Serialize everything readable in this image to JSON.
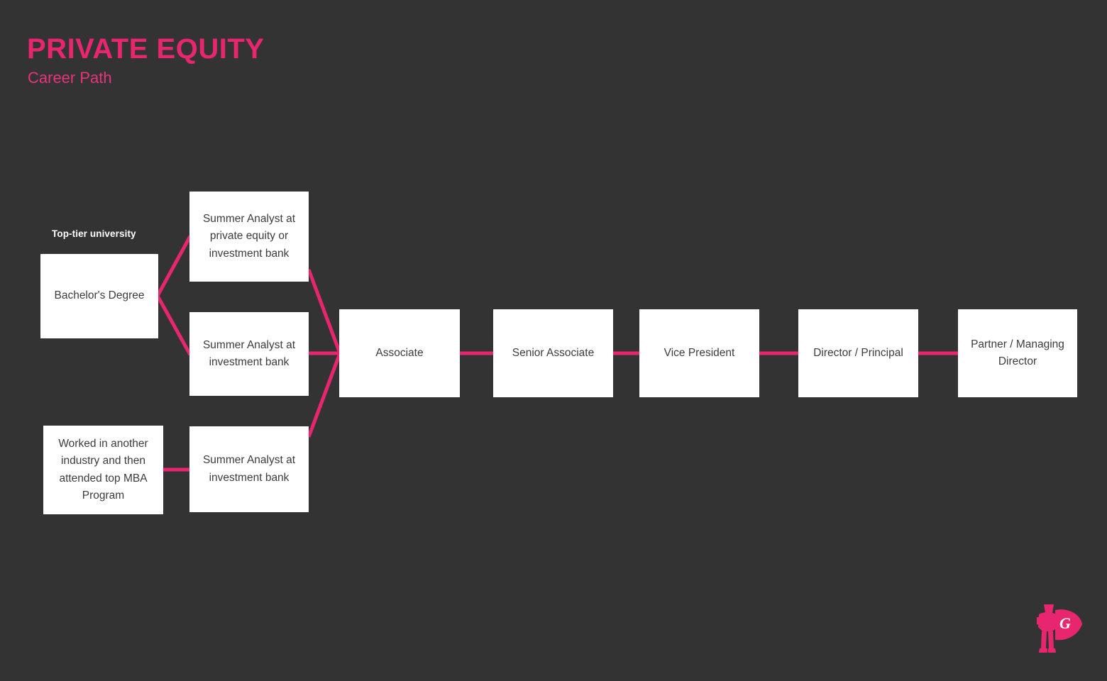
{
  "header": {
    "title": "PRIVATE EQUITY",
    "subtitle": "Career Path"
  },
  "colors": {
    "background": "#333333",
    "accent": "#E8266F",
    "node_fill": "#FFFFFF",
    "node_text": "#3C3C3C",
    "annotation_text": "#FFFFFF"
  },
  "annotations": [
    {
      "id": "top-tier-university",
      "text": "Top-tier university"
    }
  ],
  "nodes": [
    {
      "id": "bachelors-degree",
      "label": "Bachelor's Degree"
    },
    {
      "id": "summer-analyst-pe-or-ib",
      "label": "Summer Analyst at private equity or investment bank"
    },
    {
      "id": "summer-analyst-ib-upper",
      "label": "Summer Analyst at investment bank"
    },
    {
      "id": "mba-path",
      "label": "Worked in another industry and then attended top MBA Program"
    },
    {
      "id": "summer-analyst-ib-lower",
      "label": "Summer Analyst at investment bank"
    },
    {
      "id": "associate",
      "label": "Associate"
    },
    {
      "id": "senior-associate",
      "label": "Senior Associate"
    },
    {
      "id": "vice-president",
      "label": "Vice President"
    },
    {
      "id": "director-principal",
      "label": "Director / Principal"
    },
    {
      "id": "partner-managing-director",
      "label": "Partner / Managing Director"
    }
  ],
  "logo": {
    "letter": "G",
    "description": "superhero-with-cape-logo"
  }
}
